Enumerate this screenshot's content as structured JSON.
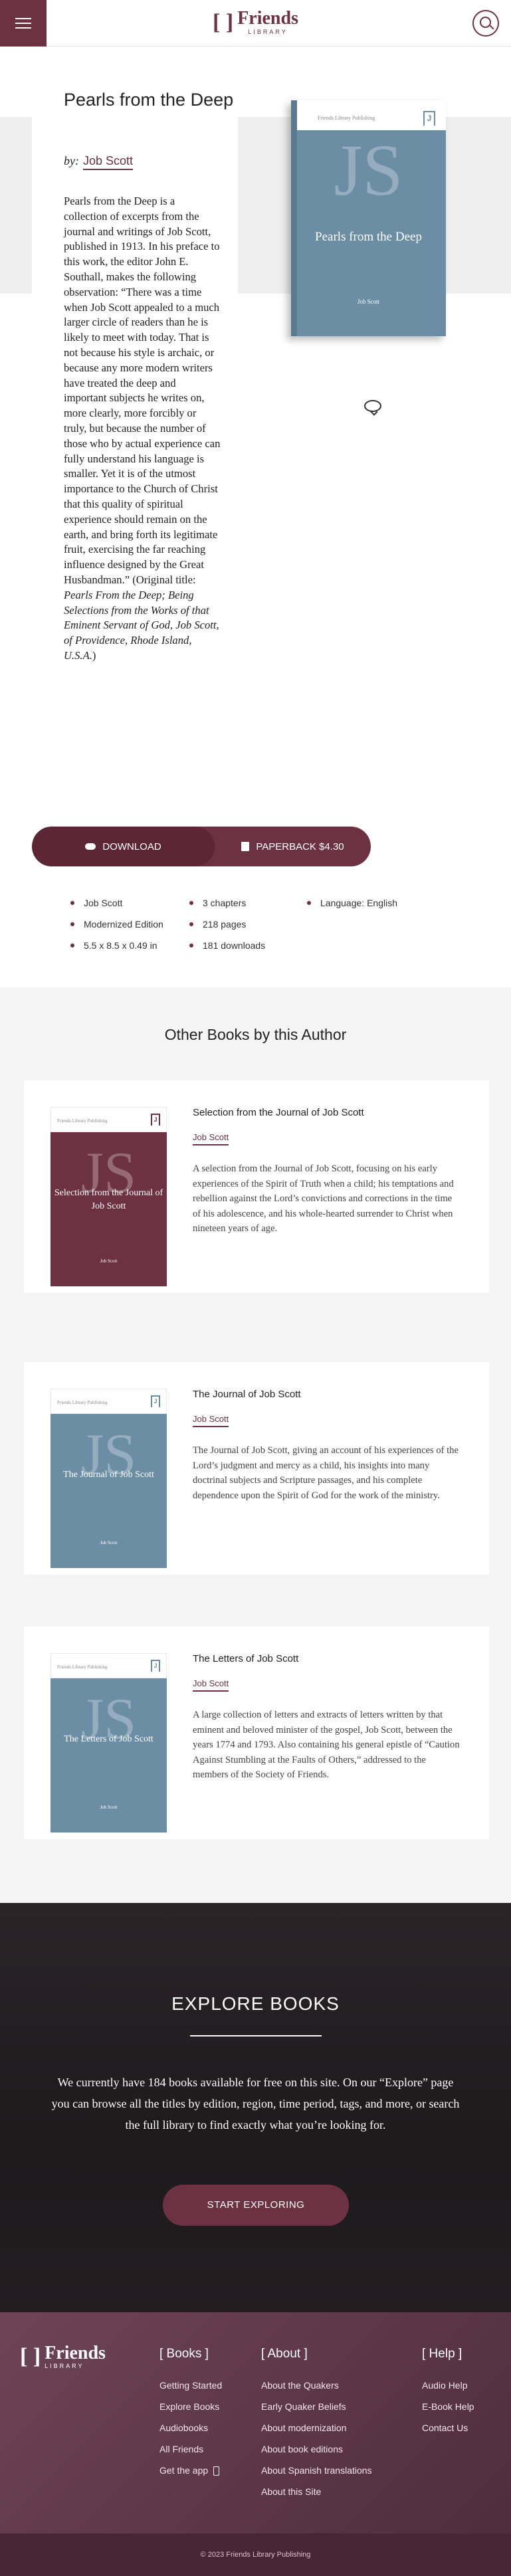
{
  "nav": {
    "logo_text": "Friends",
    "logo_sub": "LIBRARY",
    "logo_bracket": "[ ]"
  },
  "book": {
    "title": "Pearls from the Deep",
    "by": "by:",
    "author": "Job Scott",
    "description": "Pearls from the Deep is a collection of excerpts from the journal and writings of Job Scott, published in 1913. In his preface to this work, the editor John E. Southall, makes the following observation: “There was a time when Job Scott appealed to a much larger circle of readers than he is likely to meet with today. That is not because his style is archaic, or because any more modern writers have treated the deep and important subjects he writes on, more clearly, more forcibly or truly, but because the number of those who by actual experience can fully understand his language is smaller. Yet it is of the utmost importance to the Church of Christ that this quality of spiritual experience should remain on the earth, and bring forth its legitimate fruit, exercising the far reaching influence designed by the Great Husbandman.” (Original title: ",
    "original_title": "Pearls From the Deep; Being Selections from the Works of that Eminent Servant of God, Job Scott, of Providence, Rhode Island, U.S.A.",
    "closing": ")",
    "cover": {
      "publisher": "Friends Library Publishing",
      "initials": "JS",
      "title": "Pearls from the Deep",
      "author": "Job Scott",
      "color": "#6c8ea5"
    },
    "download_label": "DOWNLOAD",
    "paperback_label": "PAPERBACK $4.30",
    "meta_col1": [
      "Job Scott",
      "Modernized Edition",
      "5.5 x 8.5 x 0.49 in"
    ],
    "meta_col2": [
      "3 chapters",
      "218 pages",
      "181 downloads"
    ],
    "meta_col3": [
      "Language: English"
    ]
  },
  "other": {
    "heading": "Other Books by this Author",
    "books": [
      {
        "title": "Selection from the Journal of Job Scott",
        "author": "Job Scott",
        "description": "A selection from the Journal of Job Scott, focusing on his early experiences of the Spirit of Truth when a child; his temptations and rebellion against the Lord’s convictions and corrections in the time of his adolescence, and his whole-hearted surrender to Christ when nineteen years of age.",
        "cover_title": "Selection from the Journal of Job Scott",
        "cover_color": "#6c3142",
        "initials": "JS",
        "publisher": "Friends Library Publishing",
        "cover_author": "Job Scott"
      },
      {
        "title": "The Journal of Job Scott",
        "author": "Job Scott",
        "description": "The Journal of Job Scott, giving an account of his experiences of the Lord’s judgment and mercy as a child, his insights into many doctrinal subjects and Scripture passages, and his complete dependence upon the Spirit of God for the work of the ministry.",
        "cover_title": "The Journal of Job Scott",
        "cover_color": "#6c8ea5",
        "initials": "JS",
        "publisher": "Friends Library Publishing",
        "cover_author": "Job Scott"
      },
      {
        "title": "The Letters of Job Scott",
        "author": "Job Scott",
        "description": "A large collection of letters and extracts of letters written by that eminent and beloved minister of the gospel, Job Scott, between the years 1774 and 1793. Also containing his general epistle of “Caution Against Stumbling at the Faults of Others,” addressed to the members of the Society of Friends.",
        "cover_title": "The Letters of Job Scott",
        "cover_color": "#6c8ea5",
        "initials": "JS",
        "publisher": "Friends Library Publishing",
        "cover_author": "Job Scott"
      }
    ]
  },
  "explore": {
    "heading": "EXPLORE BOOKS",
    "text": "We currently have 184 books available for free on this site. On our “Explore” page you can browse all the titles by edition, region, time period, tags, and more, or search the full library to find exactly what you’re looking for.",
    "button": "START EXPLORING"
  },
  "footer": {
    "books_heading": "[ Books ]",
    "books_links": [
      "Getting Started",
      "Explore Books",
      "Audiobooks",
      "All Friends",
      "Get the app"
    ],
    "about_heading": "[ About ]",
    "about_links": [
      "About the Quakers",
      "Early Quaker Beliefs",
      "About modernization",
      "About book editions",
      "About Spanish translations",
      "About this Site"
    ],
    "help_heading": "[ Help ]",
    "help_links": [
      "Audio Help",
      "E-Book Help",
      "Contact Us"
    ],
    "copyright": "© 2023 Friends Library Publishing"
  }
}
